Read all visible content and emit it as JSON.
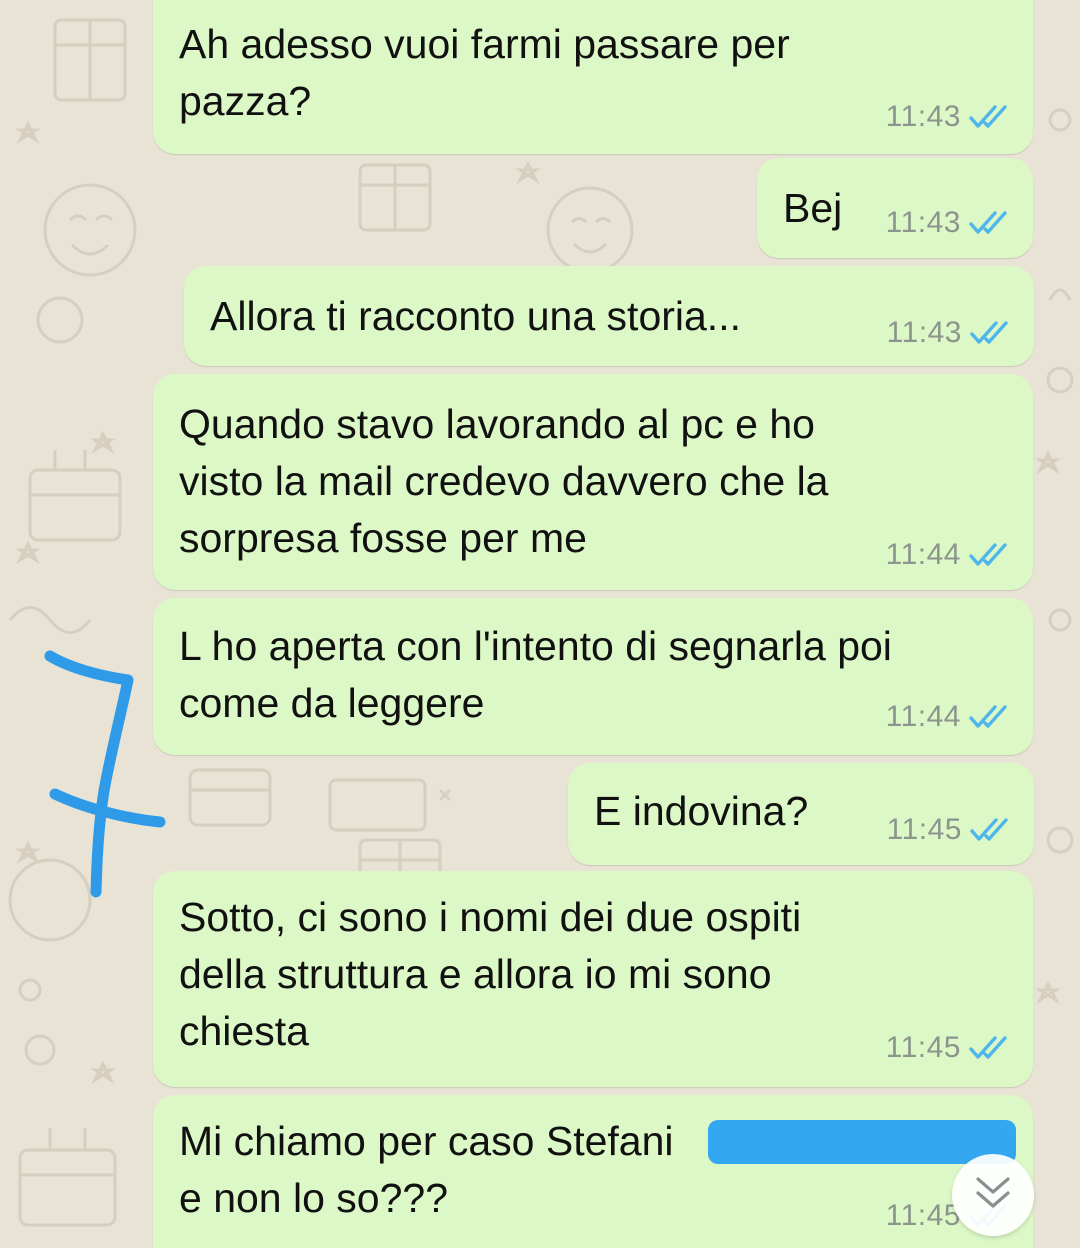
{
  "chat": {
    "messages": [
      {
        "lines": [
          "Ah adesso vuoi farmi passare per",
          "pazza?"
        ],
        "time": "11:43",
        "status": "read"
      },
      {
        "lines": [
          "Bej"
        ],
        "time": "11:43",
        "status": "read"
      },
      {
        "lines": [
          "Allora ti racconto una storia..."
        ],
        "time": "11:43",
        "status": "read"
      },
      {
        "lines": [
          "Quando stavo lavorando al pc e ho",
          "visto la mail credevo davvero che la",
          "sorpresa fosse per me"
        ],
        "time": "11:44",
        "status": "read"
      },
      {
        "lines": [
          "L ho aperta con l'intento di segnarla poi",
          "come da leggere"
        ],
        "time": "11:44",
        "status": "read"
      },
      {
        "lines": [
          "E indovina?"
        ],
        "time": "11:45",
        "status": "read"
      },
      {
        "lines": [
          "Sotto, ci sono i nomi dei due ospiti",
          "della struttura e allora io mi sono",
          "chiesta"
        ],
        "time": "11:45",
        "status": "read"
      },
      {
        "lines": [
          "Mi chiamo per caso Stefani",
          "e non lo so???"
        ],
        "time": "11:45",
        "status": "read"
      }
    ]
  },
  "colors": {
    "outgoing_bubble": "#dcf8c6",
    "wallpaper": "#e9e3d6",
    "read_check": "#4fb6ec",
    "annotation_ink": "#2f9be8"
  },
  "icons": {
    "read_receipt": "double-check-icon",
    "scroll_down": "double-chevron-down-icon"
  },
  "annotation": {
    "handwritten_number": "7"
  }
}
